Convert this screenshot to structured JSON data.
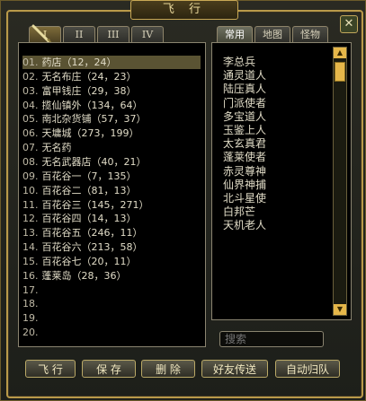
{
  "window": {
    "title": "飞 行"
  },
  "close": {
    "glyph": "✕"
  },
  "roman_tabs": [
    "I",
    "II",
    "III",
    "IV"
  ],
  "locations": [
    {
      "num": "01.",
      "name": "药店",
      "coord": "（12，24）"
    },
    {
      "num": "02.",
      "name": "无名布庄",
      "coord": "（24，23）"
    },
    {
      "num": "03.",
      "name": "富甲钱庄",
      "coord": "（29，38）"
    },
    {
      "num": "04.",
      "name": "揽仙镇外",
      "coord": "（134，64）"
    },
    {
      "num": "05.",
      "name": "南北杂货铺",
      "coord": "（57，37）"
    },
    {
      "num": "06.",
      "name": "天墉城",
      "coord": "（273，199）"
    },
    {
      "num": "07.",
      "name": "无名药",
      "coord": ""
    },
    {
      "num": "08.",
      "name": "无名武器店",
      "coord": "（40，21）"
    },
    {
      "num": "09.",
      "name": "百花谷一",
      "coord": "（7，135）"
    },
    {
      "num": "10.",
      "name": "百花谷二",
      "coord": "（81，13）"
    },
    {
      "num": "11.",
      "name": "百花谷三",
      "coord": "（145，271）"
    },
    {
      "num": "12.",
      "name": "百花谷四",
      "coord": "（14，13）"
    },
    {
      "num": "13.",
      "name": "百花谷五",
      "coord": "（246，11）"
    },
    {
      "num": "14.",
      "name": "百花谷六",
      "coord": "（213，58）"
    },
    {
      "num": "15.",
      "name": "百花谷七",
      "coord": "（20，11）"
    },
    {
      "num": "16.",
      "name": "蓬莱岛",
      "coord": "（28，36）"
    },
    {
      "num": "17.",
      "name": "",
      "coord": ""
    },
    {
      "num": "18.",
      "name": "",
      "coord": ""
    },
    {
      "num": "19.",
      "name": "",
      "coord": ""
    },
    {
      "num": "20.",
      "name": "",
      "coord": ""
    }
  ],
  "right_tabs": [
    "常用",
    "地图",
    "怪物"
  ],
  "npcs": [
    "李总兵",
    "通灵道人",
    "陆压真人",
    "门派使者",
    "多宝道人",
    "玉鉴上人",
    "太玄真君",
    "蓬莱使者",
    "赤灵尊神",
    "仙界神捕",
    "北斗星使",
    "白邦芒",
    "天机老人"
  ],
  "search": {
    "placeholder": "搜索"
  },
  "buttons": {
    "fly": "飞 行",
    "save": "保 存",
    "delete": "删 除",
    "friend_teleport": "好友传送",
    "auto_return": "自动归队"
  },
  "colors": {
    "accent": "#b99a4a",
    "selected_row": "#5a5333",
    "scroll": "#e6b74a"
  }
}
